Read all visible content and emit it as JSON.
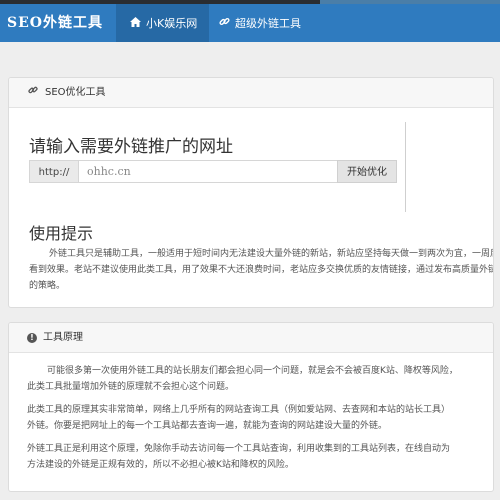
{
  "navbar": {
    "brand": "SEO外链工具",
    "items": [
      {
        "label": "小K娱乐网",
        "icon": "home-icon"
      },
      {
        "label": "超级外链工具",
        "icon": "link-icon"
      }
    ]
  },
  "seo_panel": {
    "header": "SEO优化工具",
    "header_icon": "link-icon",
    "title": "请输入需要外链推广的网址",
    "prefix": "http://",
    "url_value": "ohhc.cn",
    "submit_label": "开始优化",
    "help_title": "使用提示",
    "help_text": "外链工具只是辅助工具，一般适用于短时间内无法建设大量外链的新站，新站应坚持每天做一到两次为宜，一周后看到效果。老站不建议使用此类工具，用了效果不大还浪费时间，老站应多交换优质的友情链接，通过发布高质量外链的策略。"
  },
  "principle_panel": {
    "header": "工具原理",
    "header_icon": "info-icon",
    "paragraphs": [
      "可能很多第一次使用外链工具的站长朋友们都会担心同一个问题，就是会不会被百度K站、降权等风险，",
      "此类工具批量增加外链的原理就不会担心这个问题。",
      "此类工具的原理其实非常简单，网络上几乎所有的网站查询工具（例如爱站网、去查网和本站的站长工具）",
      "外链。你要是把网址上的每一个工具站都去查询一遍，就能为查询的网站建设大量的外链。",
      "外链工具正是利用这个原理，免除你手动去访问每一个工具站查询，利用收集到的工具站列表，在线自动为",
      "方法建设的外链是正规有效的，所以不必担心被K站和降权的风险。"
    ]
  }
}
